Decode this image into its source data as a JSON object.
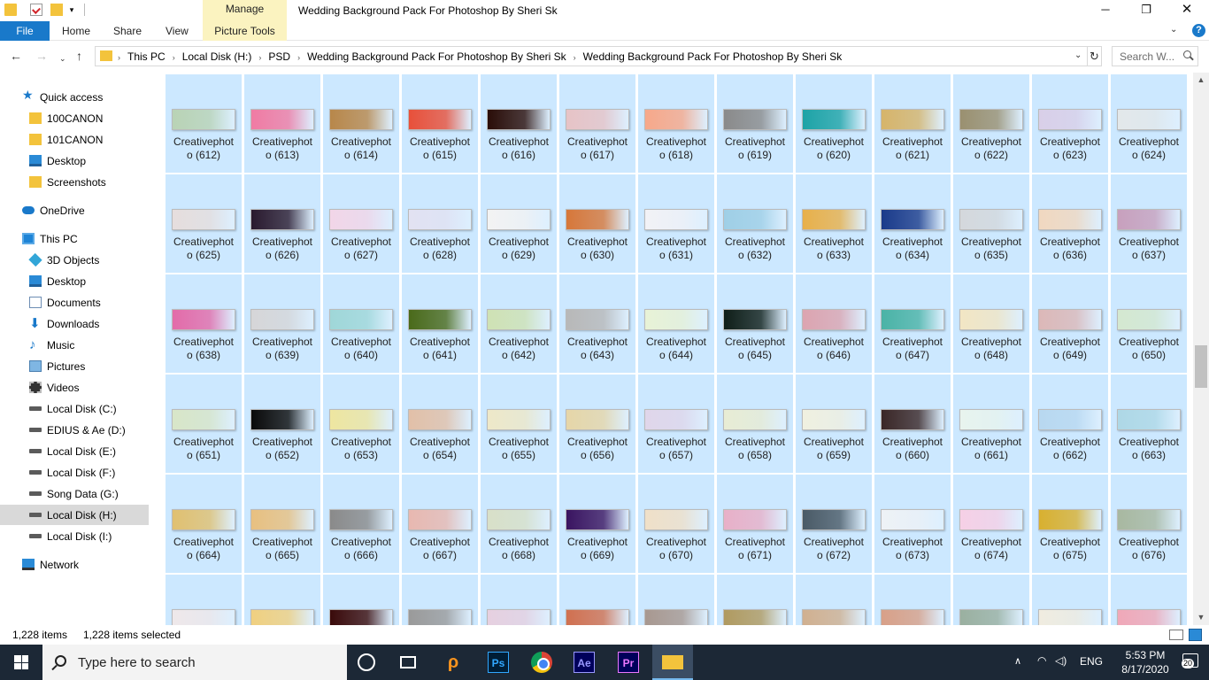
{
  "window": {
    "title": "Wedding Background Pack For Photoshop By Sheri Sk",
    "controls": {
      "minimize": "─",
      "maximize": "❐",
      "close": "✕"
    }
  },
  "quick_access_toolbar": {
    "dropdown": "▾"
  },
  "ribbon": {
    "context_group": "Manage",
    "tabs": {
      "file": "File",
      "home": "Home",
      "share": "Share",
      "view": "View",
      "picture_tools": "Picture Tools"
    },
    "expand": "⌄",
    "help": "?"
  },
  "nav_buttons": {
    "back": "←",
    "forward": "→",
    "recent": "⌄",
    "up": "↑"
  },
  "address": {
    "crumbs": [
      "This PC",
      "Local Disk (H:)",
      "PSD",
      "Wedding Background Pack For Photoshop By Sheri Sk",
      "Wedding Background Pack For Photoshop By Sheri Sk"
    ],
    "separator": "›",
    "dropdown": "⌄",
    "refresh": "↻"
  },
  "search": {
    "placeholder": "Search W..."
  },
  "nav_pane": {
    "items": [
      {
        "label": "Quick access",
        "icon": "star-icon"
      },
      {
        "label": "100CANON",
        "icon": "folder-icon"
      },
      {
        "label": "101CANON",
        "icon": "folder-icon"
      },
      {
        "label": "Desktop",
        "icon": "desktop-icon"
      },
      {
        "label": "Screenshots",
        "icon": "folder-icon"
      },
      {
        "label": "OneDrive",
        "icon": "cloud-icon"
      },
      {
        "label": "This PC",
        "icon": "computer-icon"
      },
      {
        "label": "3D Objects",
        "icon": "cube-icon"
      },
      {
        "label": "Desktop",
        "icon": "desktop-icon"
      },
      {
        "label": "Documents",
        "icon": "documents-icon"
      },
      {
        "label": "Downloads",
        "icon": "download-icon"
      },
      {
        "label": "Music",
        "icon": "music-icon"
      },
      {
        "label": "Pictures",
        "icon": "pictures-icon"
      },
      {
        "label": "Videos",
        "icon": "videos-icon"
      },
      {
        "label": "Local Disk (C:)",
        "icon": "drive-icon"
      },
      {
        "label": "EDIUS & Ae (D:)",
        "icon": "drive-icon"
      },
      {
        "label": "Local Disk (E:)",
        "icon": "drive-icon"
      },
      {
        "label": "Local Disk (F:)",
        "icon": "drive-icon"
      },
      {
        "label": "Song Data (G:)",
        "icon": "drive-icon"
      },
      {
        "label": "Local Disk (H:)",
        "icon": "drive-icon",
        "selected": true
      },
      {
        "label": "Local Disk (I:)",
        "icon": "drive-icon"
      },
      {
        "label": "Network",
        "icon": "network-icon"
      }
    ]
  },
  "files": {
    "name_line1": "Creativephot",
    "rows": [
      {
        "numbers": [
          "o (612)",
          "o (613)",
          "o (614)",
          "o (615)",
          "o (616)",
          "o (617)",
          "o (618)",
          "o (619)",
          "o (620)",
          "o (621)",
          "o (622)",
          "o (623)",
          "o (624)"
        ],
        "thumbs": [
          "#b9d3b5",
          "#f07ba3",
          "#b8874a",
          "#e8503a",
          "#2a0d08",
          "#e7c3c6",
          "#f7a88a",
          "#8a8a8a",
          "#1da3a6",
          "#d6b46a",
          "#9a9070",
          "#d9cfe8",
          "#e3e8ea"
        ]
      },
      {
        "numbers": [
          "o (625)",
          "o (626)",
          "o (627)",
          "o (628)",
          "o (629)",
          "o (630)",
          "o (631)",
          "o (632)",
          "o (633)",
          "o (634)",
          "o (635)",
          "o (636)",
          "o (637)"
        ],
        "thumbs": [
          "#e6dedd",
          "#2a1a2e",
          "#f2d6e8",
          "#e2e2f2",
          "#f3f3f3",
          "#d6773a",
          "#f2f2f6",
          "#9fcfe6",
          "#e8b04a",
          "#1a3a8a",
          "#d4d8dc",
          "#f1d8c0",
          "#c8a0bd"
        ]
      },
      {
        "numbers": [
          "o (638)",
          "o (639)",
          "o (640)",
          "o (641)",
          "o (642)",
          "o (643)",
          "o (644)",
          "o (645)",
          "o (646)",
          "o (647)",
          "o (648)",
          "o (649)",
          "o (650)"
        ],
        "thumbs": [
          "#e36ba9",
          "#d6d6d8",
          "#9fd7d8",
          "#4a6a1a",
          "#cfe2b4",
          "#b8b8b8",
          "#e8f2d6",
          "#0f1e18",
          "#dca4b0",
          "#4ab3a6",
          "#f2e6c4",
          "#dcb8b8",
          "#d4e8d0"
        ]
      },
      {
        "numbers": [
          "o (651)",
          "o (652)",
          "o (653)",
          "o (654)",
          "o (655)",
          "o (656)",
          "o (657)",
          "o (658)",
          "o (659)",
          "o (660)",
          "o (661)",
          "o (662)",
          "o (663)"
        ],
        "thumbs": [
          "#d8e6c8",
          "#0a0a0a",
          "#eee6a0",
          "#e2c0a8",
          "#eee8c8",
          "#e6d6a8",
          "#e0d6ea",
          "#e8ecd4",
          "#f0f0e0",
          "#3a2626",
          "#e8f4ee",
          "#b8d8f0",
          "#aed8e6"
        ]
      },
      {
        "numbers": [
          "o (664)",
          "o (665)",
          "o (666)",
          "o (667)",
          "o (668)",
          "o (669)",
          "o (670)",
          "o (671)",
          "o (672)",
          "o (673)",
          "o (674)",
          "o (675)",
          "o (676)"
        ],
        "thumbs": [
          "#e0c070",
          "#e8c080",
          "#8a8a8a",
          "#e8b8b0",
          "#d8e0c8",
          "#3a1460",
          "#f0e0c8",
          "#e8b0c8",
          "#4a5a66",
          "#eef2f6",
          "#f6d0e6",
          "#d8b030",
          "#a8b8a0"
        ]
      },
      {
        "numbers": [
          "",
          "",
          "",
          "",
          "",
          "",
          "",
          "",
          "",
          "",
          "",
          "",
          ""
        ],
        "thumbs": [
          "#efe8ea",
          "#f0d080",
          "#3a0a0a",
          "#9a9a9a",
          "#e6d0e0",
          "#d07050",
          "#a89890",
          "#b09a60",
          "#d0b090",
          "#d8a088",
          "#9ab0a0",
          "#f0ece0",
          "#f0a8b8"
        ]
      }
    ]
  },
  "scrollbar": {
    "up": "▲",
    "down": "▼"
  },
  "status": {
    "count": "1,228 items",
    "selected": "1,228 items selected"
  },
  "taskbar": {
    "search_placeholder": "Type here to search",
    "apps": {
      "search_app": "ρ",
      "photoshop": "Ps",
      "after_effects": "Ae",
      "premiere": "Pr"
    },
    "tray": {
      "chevron": "∧",
      "wifi": "◠",
      "volume": "◁)",
      "language": "ENG",
      "time": "5:53 PM",
      "date": "8/17/2020",
      "notifications": "20"
    }
  },
  "colors": {
    "selection": "#cce8ff",
    "file_tab": "#1979ca",
    "manage_tab": "#fbf3c0",
    "taskbar": "#1c2836"
  }
}
